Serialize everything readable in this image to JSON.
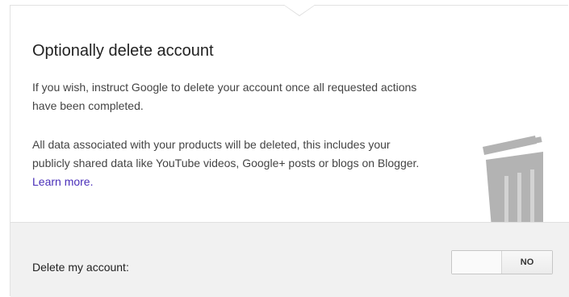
{
  "section": {
    "title": "Optionally delete account",
    "paragraph1": "If you wish, instruct Google to delete your account once all requested actions have been completed.",
    "paragraph2_text": "All data associated with your products will be deleted, this includes your publicly shared data like YouTube videos, Google+ posts or blogs on Blogger.",
    "learn_more_label": "Learn more."
  },
  "footer": {
    "label": "Delete my account:",
    "toggle_state_label": "NO",
    "toggle_on": false
  },
  "icons": {
    "illustration": "trash-can-icon"
  },
  "colors": {
    "link": "#4a2fb9",
    "trash": "#b3b3b3",
    "footer_bg": "#f1f1f1"
  }
}
